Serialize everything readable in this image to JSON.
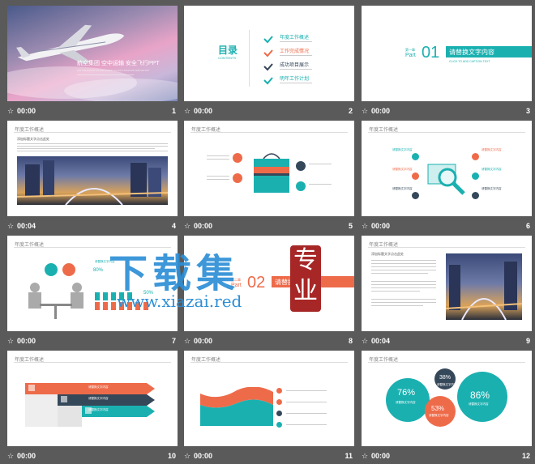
{
  "slides": [
    {
      "number": "1",
      "duration": "00:00",
      "title": "航空集团 空中运输 安全飞行PPT",
      "subtitle": "AIR TRANSPORTATION SAFETY FLIGHT AVIATION GROUP PPT"
    },
    {
      "number": "2",
      "duration": "00:00",
      "toc_title": "目录",
      "toc_sub": "CONTENTS",
      "toc_items": [
        "年度工作概述",
        "工作完成情况",
        "成功项目展示",
        "明年工作计划"
      ]
    },
    {
      "number": "3",
      "duration": "00:00",
      "part_prefix": "第一章",
      "part_label": "Part",
      "part_num": "01",
      "heading": "请替换文字内容",
      "heading_sub": "CLICK TO ADD CAPTION TEXT"
    },
    {
      "number": "4",
      "duration": "00:04",
      "header": "年度工作概述",
      "caption": "添加标题文字点击此处"
    },
    {
      "number": "5",
      "duration": "00:00",
      "header": "年度工作概述"
    },
    {
      "number": "6",
      "duration": "00:00",
      "header": "年度工作概述",
      "labels": [
        "请替换文字内容",
        "请替换文字内容",
        "请替换文字内容",
        "请替换文字内容",
        "请替换文字内容",
        "请替换文字内容"
      ]
    },
    {
      "number": "7",
      "duration": "00:00",
      "header": "年度工作概述",
      "label": "请替换文字内容",
      "stat1": "80%",
      "stat2": "50%"
    },
    {
      "number": "8",
      "duration": "00:00",
      "part_prefix": "第二章",
      "part_label": "Part",
      "part_num": "02",
      "heading": "请替换文"
    },
    {
      "number": "9",
      "duration": "00:04",
      "header": "年度工作概述",
      "caption": "添加标题文字点击此处"
    },
    {
      "number": "10",
      "duration": "00:00",
      "header": "年度工作概述",
      "arrow_labels": [
        "请替换文字内容",
        "请替换文字内容",
        "请替换文字内容"
      ]
    },
    {
      "number": "11",
      "duration": "00:00",
      "header": "年度工作概述"
    },
    {
      "number": "12",
      "duration": "00:00",
      "header": "年度工作概述",
      "pcts": [
        "76%",
        "38%",
        "53%",
        "86%"
      ],
      "labels": [
        "请替换文字内容",
        "请替换文字内容",
        "请替换文字内容",
        "请替换文字内容"
      ]
    }
  ],
  "watermark": {
    "big": "下载集",
    "url": "www.xiazai.red",
    "seal": "专业"
  },
  "colors": {
    "teal": "#1bb0b0",
    "coral": "#ee6b4a",
    "navy": "#35485a",
    "background": "#5a5a5a"
  }
}
